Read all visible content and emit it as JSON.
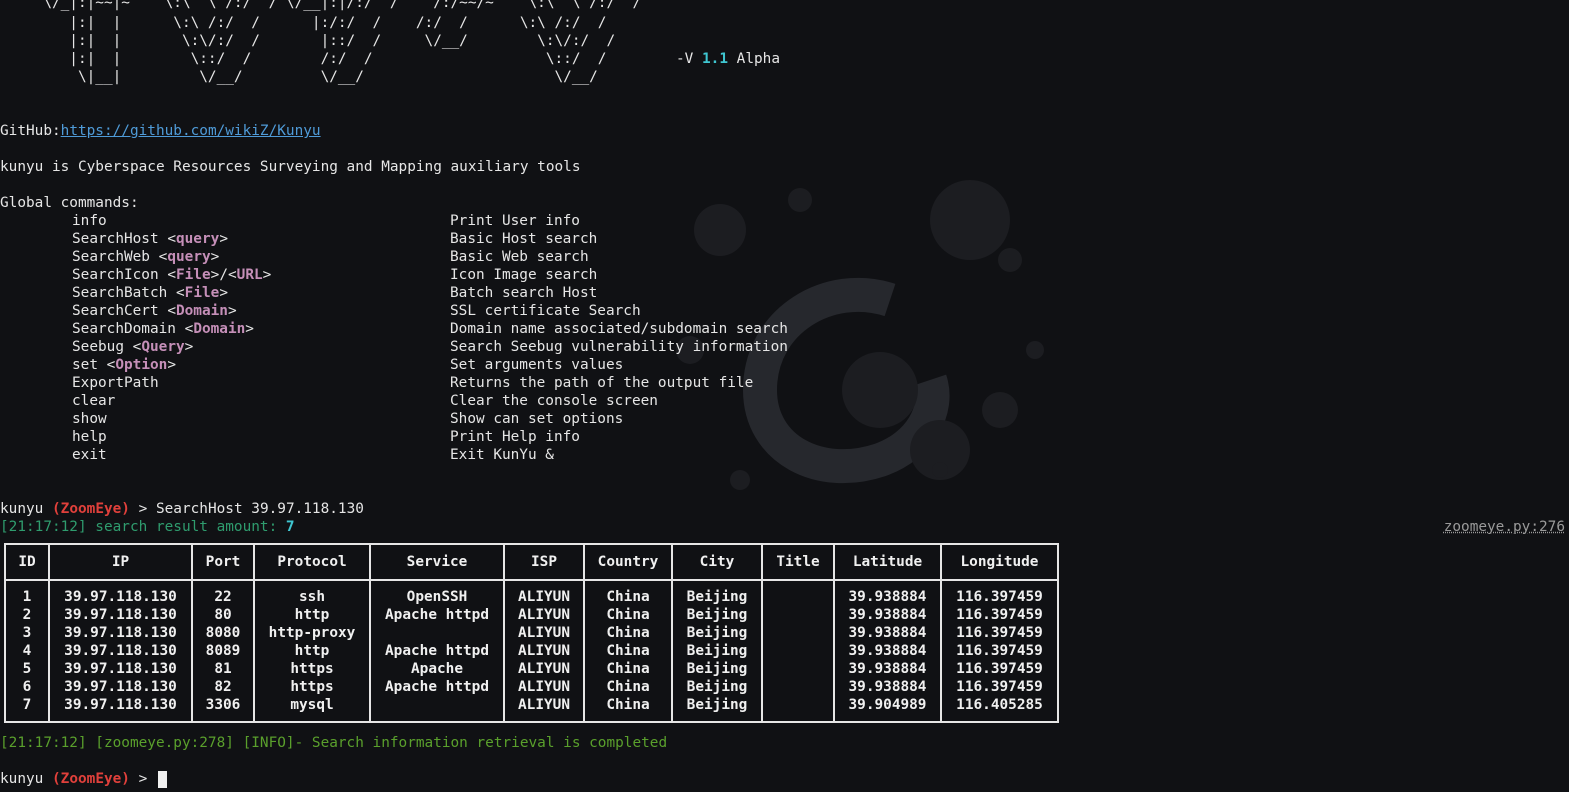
{
  "banner": {
    "ascii_lines": [
      "     \\/_|:|~~|~    \\:\\  \\ /:/  / \\/__|:|/:/  /    /:/~~/~    \\:\\  \\ /:/  /",
      "        |:|  |      \\:\\ /:/  /      |:/:/  /    /:/  /      \\:\\ /:/  /",
      "        |:|  |       \\:\\/:/  /       |::/  /     \\/__/        \\:\\/:/  /",
      "        |:|  |        \\::/  /        /:/  /                    \\::/  /",
      "         \\|__|         \\/__/         \\/__/                      \\/__/"
    ],
    "version_prefix": "-V ",
    "version": "1.1",
    "version_suffix": " Alpha"
  },
  "github": {
    "label": "GitHub:",
    "url": "https://github.com/wikiZ/Kunyu"
  },
  "tagline": "kunyu is Cyberspace Resources Surveying and Mapping auxiliary tools",
  "global_commands_label": "Global commands:",
  "commands": [
    {
      "name": "info",
      "args": [],
      "desc": "Print User info"
    },
    {
      "name": "SearchHost",
      "args": [
        "query"
      ],
      "desc": "Basic Host search"
    },
    {
      "name": "SearchWeb",
      "args": [
        "query"
      ],
      "desc": "Basic Web search"
    },
    {
      "name": "SearchIcon",
      "args": [
        "File",
        "URL"
      ],
      "desc": "Icon Image search"
    },
    {
      "name": "SearchBatch",
      "args": [
        "File"
      ],
      "desc": "Batch search Host"
    },
    {
      "name": "SearchCert",
      "args": [
        "Domain"
      ],
      "desc": "SSL certificate Search"
    },
    {
      "name": "SearchDomain",
      "args": [
        "Domain"
      ],
      "desc": "Domain name associated/subdomain search"
    },
    {
      "name": "Seebug",
      "args": [
        "Query"
      ],
      "desc": "Search Seebug vulnerability information"
    },
    {
      "name": "set",
      "args": [
        "Option"
      ],
      "desc": "Set arguments values"
    },
    {
      "name": "ExportPath",
      "args": [],
      "desc": "Returns the path of the output file"
    },
    {
      "name": "clear",
      "args": [],
      "desc": "Clear the console screen"
    },
    {
      "name": "show",
      "args": [],
      "desc": "Show can set options"
    },
    {
      "name": "help",
      "args": [],
      "desc": "Print Help info"
    },
    {
      "name": "exit",
      "args": [],
      "desc": "Exit KunYu &"
    }
  ],
  "prompt": {
    "user": "kunyu",
    "module": "(ZoomEye)",
    "arrow": " > "
  },
  "executed_command": "SearchHost 39.97.118.130",
  "result_summary": {
    "time": "[21:17:12]",
    "text": " search result amount: ",
    "amount": "7"
  },
  "source_ref": "zoomeye.py:276",
  "table": {
    "headers": [
      "ID",
      "IP",
      "Port",
      "Protocol",
      "Service",
      "ISP",
      "Country",
      "City",
      "Title",
      "Latitude",
      "Longitude"
    ],
    "rows": [
      [
        "1",
        "39.97.118.130",
        "22",
        "ssh",
        "OpenSSH",
        "ALIYUN",
        "China",
        "Beijing",
        "",
        "39.938884",
        "116.397459"
      ],
      [
        "2",
        "39.97.118.130",
        "80",
        "http",
        "Apache httpd",
        "ALIYUN",
        "China",
        "Beijing",
        "",
        "39.938884",
        "116.397459"
      ],
      [
        "3",
        "39.97.118.130",
        "8080",
        "http-proxy",
        "",
        "ALIYUN",
        "China",
        "Beijing",
        "",
        "39.938884",
        "116.397459"
      ],
      [
        "4",
        "39.97.118.130",
        "8089",
        "http",
        "Apache httpd",
        "ALIYUN",
        "China",
        "Beijing",
        "",
        "39.938884",
        "116.397459"
      ],
      [
        "5",
        "39.97.118.130",
        "81",
        "https",
        "Apache",
        "ALIYUN",
        "China",
        "Beijing",
        "",
        "39.938884",
        "116.397459"
      ],
      [
        "6",
        "39.97.118.130",
        "82",
        "https",
        "Apache httpd",
        "ALIYUN",
        "China",
        "Beijing",
        "",
        "39.938884",
        "116.397459"
      ],
      [
        "7",
        "39.97.118.130",
        "3306",
        "mysql",
        "",
        "ALIYUN",
        "China",
        "Beijing",
        "",
        "39.904989",
        "116.405285"
      ]
    ]
  },
  "info_line": "[21:17:12] [zoomeye.py:278] [INFO]- Search information retrieval is completed",
  "colors": {
    "background": "#101114",
    "prompt_red": "#e0403b",
    "cyan": "#3fc6d1",
    "arg_purple": "#c58fb8",
    "info_green": "#5aa02c"
  },
  "icons": {
    "background_logo": "debian-swirl-icon"
  }
}
